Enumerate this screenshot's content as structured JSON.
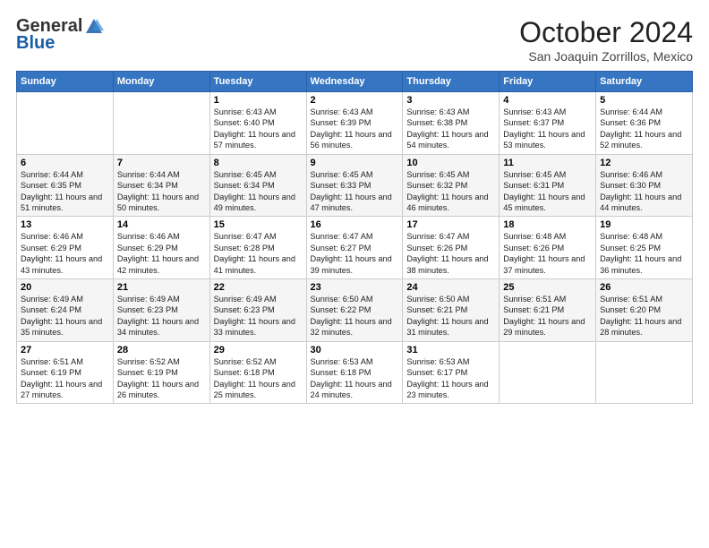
{
  "header": {
    "logo_general": "General",
    "logo_blue": "Blue",
    "month": "October 2024",
    "location": "San Joaquin Zorrillos, Mexico"
  },
  "days_of_week": [
    "Sunday",
    "Monday",
    "Tuesday",
    "Wednesday",
    "Thursday",
    "Friday",
    "Saturday"
  ],
  "weeks": [
    [
      {
        "day": "",
        "info": ""
      },
      {
        "day": "",
        "info": ""
      },
      {
        "day": "1",
        "info": "Sunrise: 6:43 AM\nSunset: 6:40 PM\nDaylight: 11 hours and 57 minutes."
      },
      {
        "day": "2",
        "info": "Sunrise: 6:43 AM\nSunset: 6:39 PM\nDaylight: 11 hours and 56 minutes."
      },
      {
        "day": "3",
        "info": "Sunrise: 6:43 AM\nSunset: 6:38 PM\nDaylight: 11 hours and 54 minutes."
      },
      {
        "day": "4",
        "info": "Sunrise: 6:43 AM\nSunset: 6:37 PM\nDaylight: 11 hours and 53 minutes."
      },
      {
        "day": "5",
        "info": "Sunrise: 6:44 AM\nSunset: 6:36 PM\nDaylight: 11 hours and 52 minutes."
      }
    ],
    [
      {
        "day": "6",
        "info": "Sunrise: 6:44 AM\nSunset: 6:35 PM\nDaylight: 11 hours and 51 minutes."
      },
      {
        "day": "7",
        "info": "Sunrise: 6:44 AM\nSunset: 6:34 PM\nDaylight: 11 hours and 50 minutes."
      },
      {
        "day": "8",
        "info": "Sunrise: 6:45 AM\nSunset: 6:34 PM\nDaylight: 11 hours and 49 minutes."
      },
      {
        "day": "9",
        "info": "Sunrise: 6:45 AM\nSunset: 6:33 PM\nDaylight: 11 hours and 47 minutes."
      },
      {
        "day": "10",
        "info": "Sunrise: 6:45 AM\nSunset: 6:32 PM\nDaylight: 11 hours and 46 minutes."
      },
      {
        "day": "11",
        "info": "Sunrise: 6:45 AM\nSunset: 6:31 PM\nDaylight: 11 hours and 45 minutes."
      },
      {
        "day": "12",
        "info": "Sunrise: 6:46 AM\nSunset: 6:30 PM\nDaylight: 11 hours and 44 minutes."
      }
    ],
    [
      {
        "day": "13",
        "info": "Sunrise: 6:46 AM\nSunset: 6:29 PM\nDaylight: 11 hours and 43 minutes."
      },
      {
        "day": "14",
        "info": "Sunrise: 6:46 AM\nSunset: 6:29 PM\nDaylight: 11 hours and 42 minutes."
      },
      {
        "day": "15",
        "info": "Sunrise: 6:47 AM\nSunset: 6:28 PM\nDaylight: 11 hours and 41 minutes."
      },
      {
        "day": "16",
        "info": "Sunrise: 6:47 AM\nSunset: 6:27 PM\nDaylight: 11 hours and 39 minutes."
      },
      {
        "day": "17",
        "info": "Sunrise: 6:47 AM\nSunset: 6:26 PM\nDaylight: 11 hours and 38 minutes."
      },
      {
        "day": "18",
        "info": "Sunrise: 6:48 AM\nSunset: 6:26 PM\nDaylight: 11 hours and 37 minutes."
      },
      {
        "day": "19",
        "info": "Sunrise: 6:48 AM\nSunset: 6:25 PM\nDaylight: 11 hours and 36 minutes."
      }
    ],
    [
      {
        "day": "20",
        "info": "Sunrise: 6:49 AM\nSunset: 6:24 PM\nDaylight: 11 hours and 35 minutes."
      },
      {
        "day": "21",
        "info": "Sunrise: 6:49 AM\nSunset: 6:23 PM\nDaylight: 11 hours and 34 minutes."
      },
      {
        "day": "22",
        "info": "Sunrise: 6:49 AM\nSunset: 6:23 PM\nDaylight: 11 hours and 33 minutes."
      },
      {
        "day": "23",
        "info": "Sunrise: 6:50 AM\nSunset: 6:22 PM\nDaylight: 11 hours and 32 minutes."
      },
      {
        "day": "24",
        "info": "Sunrise: 6:50 AM\nSunset: 6:21 PM\nDaylight: 11 hours and 31 minutes."
      },
      {
        "day": "25",
        "info": "Sunrise: 6:51 AM\nSunset: 6:21 PM\nDaylight: 11 hours and 29 minutes."
      },
      {
        "day": "26",
        "info": "Sunrise: 6:51 AM\nSunset: 6:20 PM\nDaylight: 11 hours and 28 minutes."
      }
    ],
    [
      {
        "day": "27",
        "info": "Sunrise: 6:51 AM\nSunset: 6:19 PM\nDaylight: 11 hours and 27 minutes."
      },
      {
        "day": "28",
        "info": "Sunrise: 6:52 AM\nSunset: 6:19 PM\nDaylight: 11 hours and 26 minutes."
      },
      {
        "day": "29",
        "info": "Sunrise: 6:52 AM\nSunset: 6:18 PM\nDaylight: 11 hours and 25 minutes."
      },
      {
        "day": "30",
        "info": "Sunrise: 6:53 AM\nSunset: 6:18 PM\nDaylight: 11 hours and 24 minutes."
      },
      {
        "day": "31",
        "info": "Sunrise: 6:53 AM\nSunset: 6:17 PM\nDaylight: 11 hours and 23 minutes."
      },
      {
        "day": "",
        "info": ""
      },
      {
        "day": "",
        "info": ""
      }
    ]
  ]
}
